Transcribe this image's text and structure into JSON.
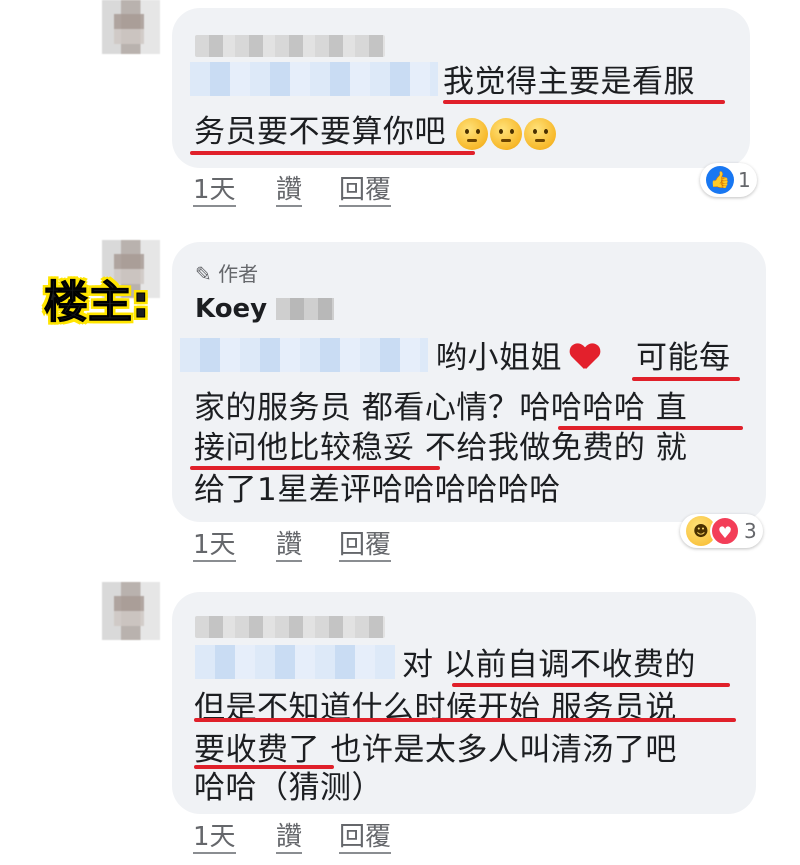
{
  "comments": [
    {
      "lines": [
        "我觉得主要是看服",
        "务员要不要算你吧"
      ],
      "actions": {
        "time": "1天",
        "like": "讚",
        "reply": "回覆"
      },
      "reaction_count": "1"
    },
    {
      "op_label": "楼主:",
      "author_badge": "作者",
      "author_name": "Koey",
      "lines": [
        "哟小姐姐",
        "可能每",
        "家的服务员 都看心情？哈哈哈哈 直",
        "接问他比较稳妥 不给我做免费的 就",
        "给了1星差评哈哈哈哈哈哈"
      ],
      "actions": {
        "time": "1天",
        "like": "讚",
        "reply": "回覆"
      },
      "reaction_count": "3"
    },
    {
      "lines": [
        "对 以前自调不收费的",
        "但是不知道什么时候开始 服务员说",
        "要收费了 也许是太多人叫清汤了吧",
        "哈哈（猜测）"
      ],
      "actions": {
        "time": "1天",
        "like": "讚",
        "reply": "回覆"
      }
    }
  ],
  "colors": {
    "bubble": "#f0f2f5",
    "underline": "#e0202a",
    "like_blue": "#1877f2",
    "label_highlight": "#ffe500"
  },
  "icons": {
    "thinking": "thinking-face-emoji",
    "heart": "red-heart-emoji",
    "like": "like-icon",
    "haha": "haha-icon",
    "love": "love-icon",
    "edit": "pencil-icon"
  }
}
